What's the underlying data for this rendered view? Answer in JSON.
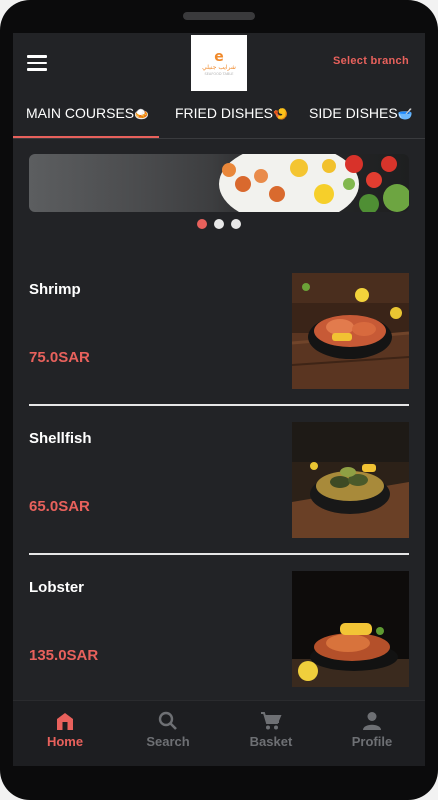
{
  "header": {
    "logo": {
      "mark": "e",
      "arabic_text": "شرايب جنبلي",
      "english_text": "SEAFOOD TABLE"
    },
    "select_branch_label": "Select branch"
  },
  "tabs": [
    {
      "label": "MAIN COURSES",
      "emoji": "🍛",
      "active": true
    },
    {
      "label": "FRIED DISHES",
      "emoji": "🍤",
      "active": false
    },
    {
      "label": "SIDE DISHES",
      "emoji": "🥣",
      "active": false
    }
  ],
  "carousel": {
    "count": 3,
    "active_index": 0
  },
  "menu_items": [
    {
      "name": "Shrimp",
      "price": "75.0SAR"
    },
    {
      "name": "Shellfish",
      "price": "65.0SAR"
    },
    {
      "name": "Lobster",
      "price": "135.0SAR"
    }
  ],
  "bottom_nav": [
    {
      "label": "Home",
      "icon": "home-icon",
      "active": true
    },
    {
      "label": "Search",
      "icon": "search-icon",
      "active": false
    },
    {
      "label": "Basket",
      "icon": "cart-icon",
      "active": false
    },
    {
      "label": "Profile",
      "icon": "person-icon",
      "active": false
    }
  ],
  "colors": {
    "accent": "#e8615c",
    "background": "#222326",
    "bottom_bar": "#1d1e21",
    "inactive_nav": "#6e7074",
    "text": "#ffffff"
  }
}
